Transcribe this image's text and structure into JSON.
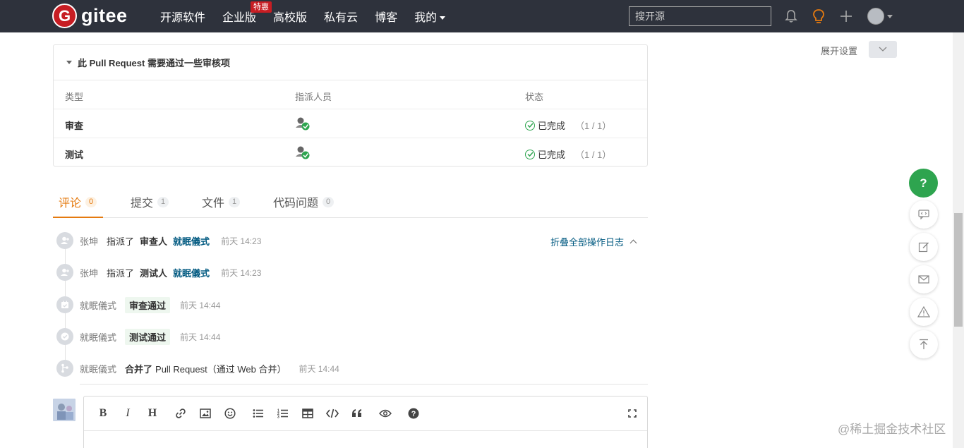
{
  "nav": {
    "logo_letter": "G",
    "logo_text": "gitee",
    "items": [
      {
        "label": "开源软件"
      },
      {
        "label": "企业版",
        "badge": "特惠"
      },
      {
        "label": "高校版"
      },
      {
        "label": "私有云"
      },
      {
        "label": "博客"
      },
      {
        "label": "我的"
      }
    ],
    "search_placeholder": "搜开源"
  },
  "settings": {
    "expand_label": "展开设置"
  },
  "review": {
    "title": "此 Pull Request 需要通过一些审核项",
    "columns": [
      "类型",
      "指派人员",
      "状态"
    ],
    "rows": [
      {
        "type": "审查",
        "status": "已完成",
        "count": "（1 / 1）"
      },
      {
        "type": "测试",
        "status": "已完成",
        "count": "（1 / 1）"
      }
    ]
  },
  "tabs": [
    {
      "label": "评论",
      "count": "0"
    },
    {
      "label": "提交",
      "count": "1"
    },
    {
      "label": "文件",
      "count": "1"
    },
    {
      "label": "代码问题",
      "count": "0"
    }
  ],
  "timeline": {
    "fold_label": "折叠全部操作日志",
    "events": [
      {
        "user": "张坤",
        "action": "指派了",
        "role": "审查人",
        "target": "就眠儀式",
        "time": "前天 14:23"
      },
      {
        "user": "张坤",
        "action": "指派了",
        "role": "测试人",
        "target": "就眠儀式",
        "time": "前天 14:23"
      },
      {
        "user": "就眠儀式",
        "tag": "审查通过",
        "time": "前天 14:44"
      },
      {
        "user": "就眠儀式",
        "tag": "测试通过",
        "time": "前天 14:44"
      },
      {
        "user": "就眠儀式",
        "action": "合并了",
        "rest": "Pull Request（通过 Web 合并）",
        "time": "前天 14:44"
      }
    ]
  },
  "editor": {
    "toolbar": [
      "B",
      "I",
      "H",
      "link-icon",
      "image-icon",
      "emoji-icon",
      "bullet-list-icon",
      "numbered-list-icon",
      "table-icon",
      "code-icon",
      "quote-icon",
      "preview-icon",
      "help-icon",
      "fullscreen-icon"
    ]
  },
  "float": {
    "help_label": "?"
  },
  "watermark": "@稀土掘金技术社区",
  "colors": {
    "nav_bg": "#2e323c",
    "brand": "#c71d23",
    "accent": "#e57a0f",
    "success": "#2ea44f",
    "link": "#005980"
  }
}
